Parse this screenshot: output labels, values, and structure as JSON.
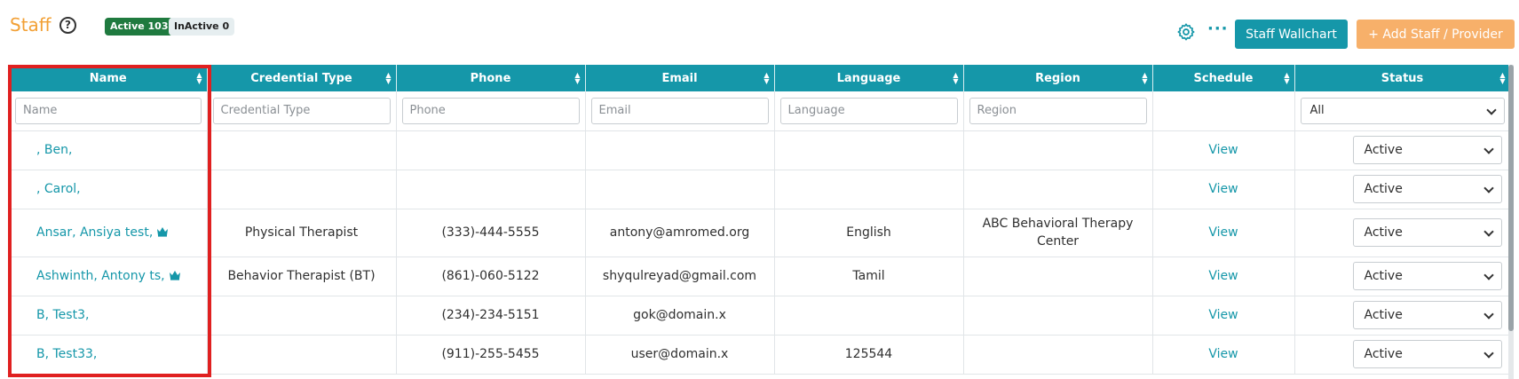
{
  "header": {
    "title": "Staff",
    "help_icon": "question-circle-icon",
    "badge_active": "Active 103",
    "badge_inactive": "InActive 0",
    "settings_icon": "gear-icon",
    "more_icon": "ellipsis-icon",
    "wallchart_label": "Staff Wallchart",
    "add_label": "+ Add Staff / Provider"
  },
  "colors": {
    "accent": "#1597a9",
    "title": "#f2a035",
    "add_button": "#f7b06a",
    "active_badge": "#1f7a3f",
    "highlight": "#e02020"
  },
  "table": {
    "columns": [
      "Name",
      "Credential Type",
      "Phone",
      "Email",
      "Language",
      "Region",
      "Schedule",
      "Status"
    ],
    "filters": {
      "name": "Name",
      "credential": "Credential Type",
      "phone": "Phone",
      "email": "Email",
      "language": "Language",
      "region": "Region",
      "status": "All"
    },
    "rows": [
      {
        "name": ", Ben,",
        "credential": "",
        "phone": "",
        "email": "",
        "language": "",
        "region": "",
        "schedule": "View",
        "status": "Active",
        "crown": false
      },
      {
        "name": ", Carol,",
        "credential": "",
        "phone": "",
        "email": "",
        "language": "",
        "region": "",
        "schedule": "View",
        "status": "Active",
        "crown": false
      },
      {
        "name": "Ansar, Ansiya test,",
        "credential": "Physical Therapist",
        "phone": "(333)-444-5555",
        "email": "antony@amromed.org",
        "language": "English",
        "region": "ABC Behavioral Therapy Center",
        "schedule": "View",
        "status": "Active",
        "crown": true
      },
      {
        "name": "Ashwinth, Antony ts,",
        "credential": "Behavior Therapist (BT)",
        "phone": "(861)-060-5122",
        "email": "shyqulreyad@gmail.com",
        "language": "Tamil",
        "region": "",
        "schedule": "View",
        "status": "Active",
        "crown": true
      },
      {
        "name": "B, Test3,",
        "credential": "",
        "phone": "(234)-234-5151",
        "email": "gok@domain.x",
        "language": "",
        "region": "",
        "schedule": "View",
        "status": "Active",
        "crown": false
      },
      {
        "name": "B, Test33,",
        "credential": "",
        "phone": "(911)-255-5455",
        "email": "user@domain.x",
        "language": "125544",
        "region": "",
        "schedule": "View",
        "status": "Active",
        "crown": false
      }
    ]
  }
}
